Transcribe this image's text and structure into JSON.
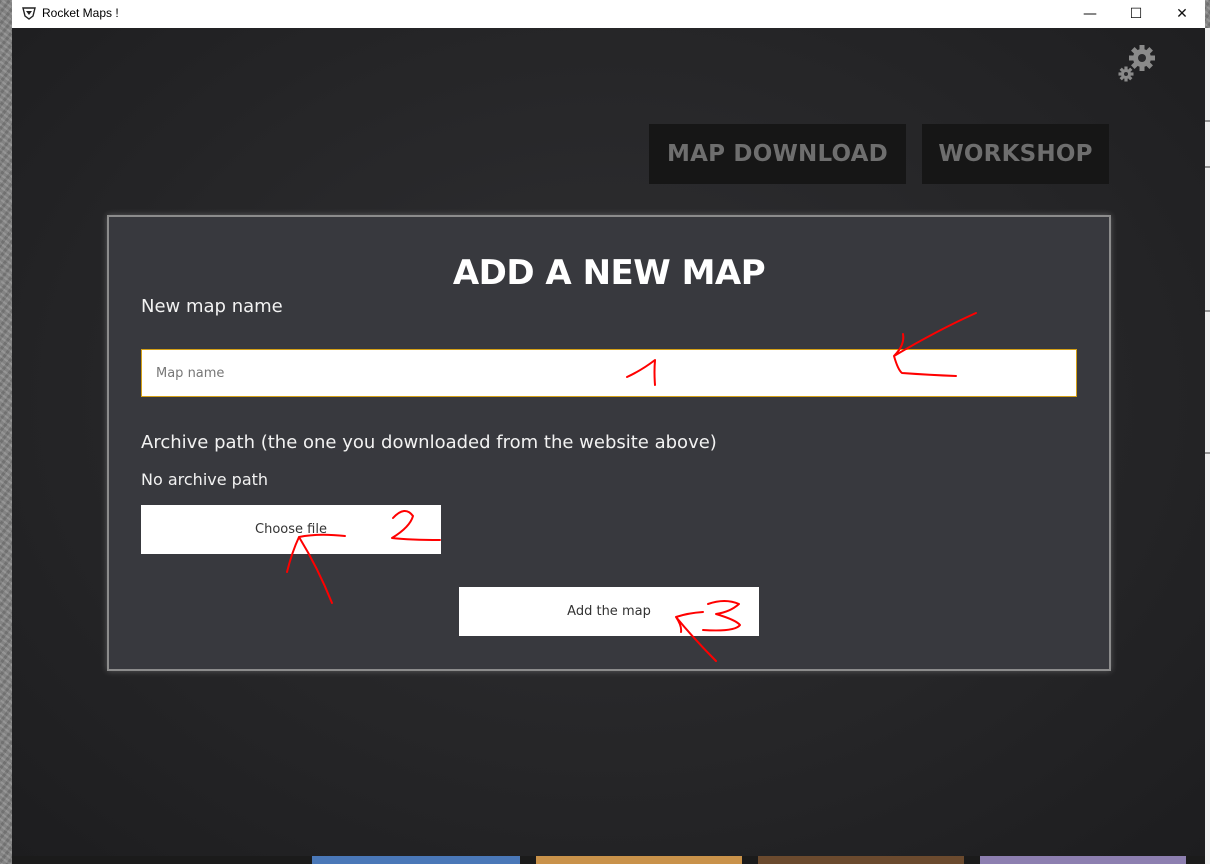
{
  "window": {
    "title": "Rocket Maps !",
    "controls": {
      "minimize": "—",
      "maximize": "☐",
      "close": "✕"
    }
  },
  "nav": {
    "map_download": "MAP DOWNLOAD",
    "workshop": "WORKSHOP"
  },
  "icons": {
    "settings": "gear-icon"
  },
  "form": {
    "title": "ADD A NEW MAP",
    "map_name_label": "New map name",
    "map_name_placeholder": "Map name",
    "map_name_value": "",
    "archive_label": "Archive path (the one you downloaded from the website above)",
    "archive_status": "No archive path",
    "choose_file_button": "Choose file",
    "add_button": "Add the map"
  },
  "annotations": {
    "color": "#ff0000"
  },
  "colors": {
    "input_border": "#d4a017",
    "nav_text": "#6e6e6e",
    "panel_bg": "#38393e"
  }
}
